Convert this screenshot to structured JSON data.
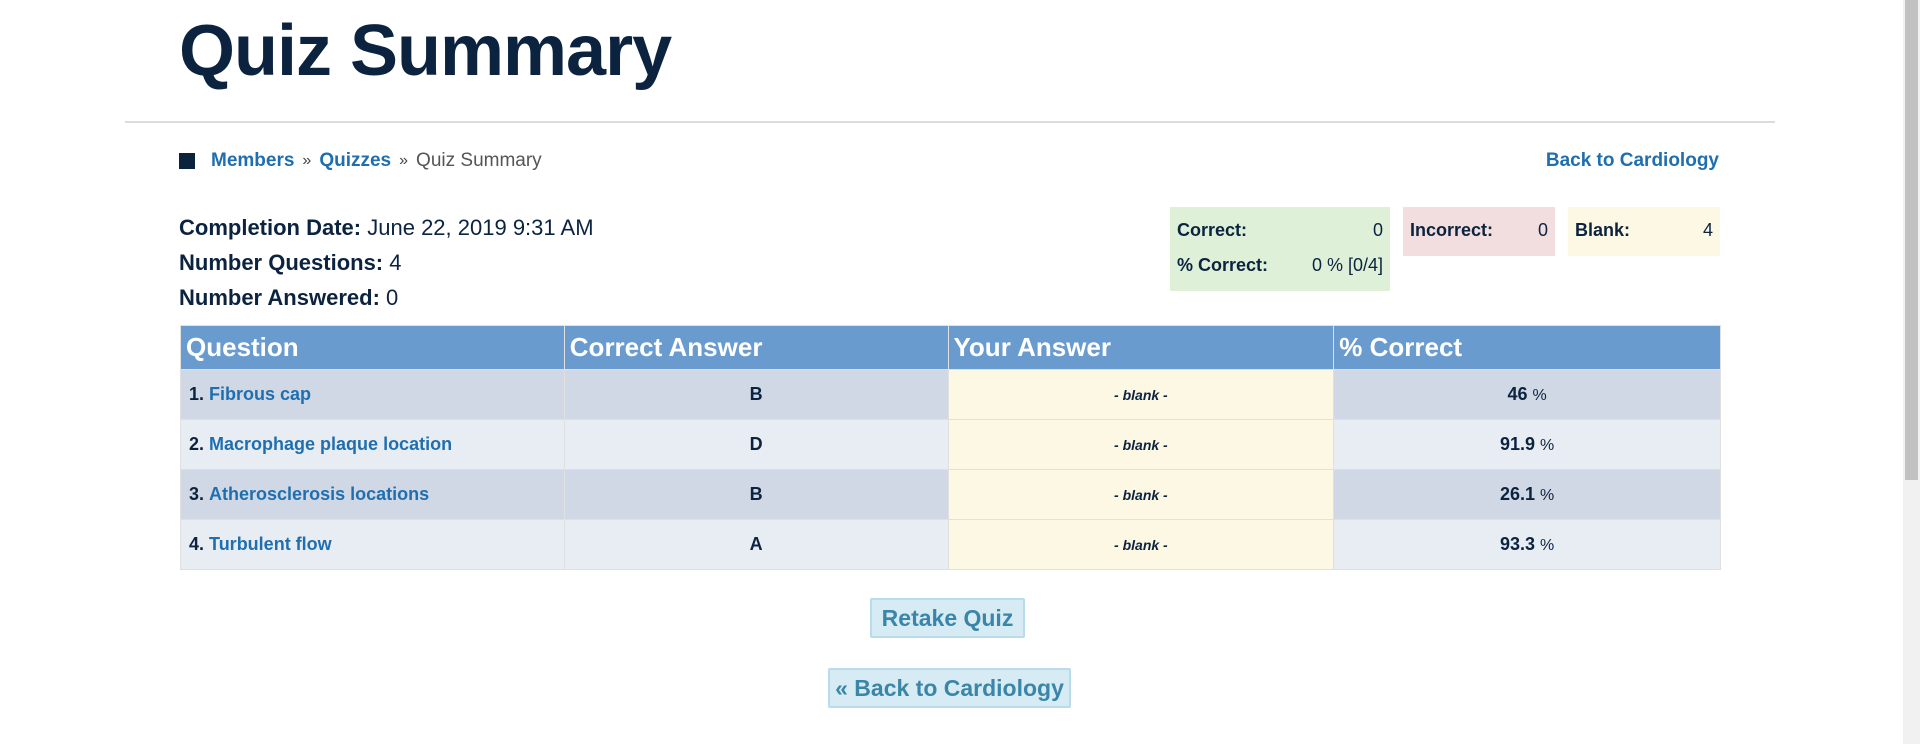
{
  "page": {
    "title": "Quiz Summary"
  },
  "breadcrumb": {
    "items": [
      "Members",
      "Quizzes"
    ],
    "separator": "»",
    "current": "Quiz Summary"
  },
  "top_back_link": "Back to Cardiology",
  "meta": {
    "completion_label": "Completion Date:",
    "completion_value": "June 22, 2019 9:31 AM",
    "questions_label": "Number Questions:",
    "questions_value": "4",
    "answered_label": "Number Answered:",
    "answered_value": "0"
  },
  "stats": {
    "correct_label": "Correct:",
    "correct_value": "0",
    "pct_label": "% Correct:",
    "pct_value": "0 % [0/4]",
    "incorrect_label": "Incorrect:",
    "incorrect_value": "0",
    "blank_label": "Blank:",
    "blank_value": "4",
    "colors": {
      "correct_bg": "#dff0d8",
      "incorrect_bg": "#f2dede",
      "blank_bg": "#fcf8e3"
    }
  },
  "table": {
    "headers": [
      "Question",
      "Correct Answer",
      "Your Answer",
      "% Correct"
    ],
    "rows": [
      {
        "num": "1.",
        "question": "Fibrous cap",
        "correct": "B",
        "yours": "- blank -",
        "pct": "46",
        "unit": "%"
      },
      {
        "num": "2.",
        "question": "Macrophage plaque location",
        "correct": "D",
        "yours": "- blank -",
        "pct": "91.9",
        "unit": "%"
      },
      {
        "num": "3.",
        "question": "Atherosclerosis locations",
        "correct": "B",
        "yours": "- blank -",
        "pct": "26.1",
        "unit": "%"
      },
      {
        "num": "4.",
        "question": "Turbulent flow",
        "correct": "A",
        "yours": "- blank -",
        "pct": "93.3",
        "unit": "%"
      }
    ]
  },
  "buttons": {
    "retake": "Retake Quiz",
    "back": "« Back to Cardiology"
  },
  "colors": {
    "header_bg": "#6a9bcf",
    "link": "#1f6fb0",
    "title": "#0c2340"
  }
}
